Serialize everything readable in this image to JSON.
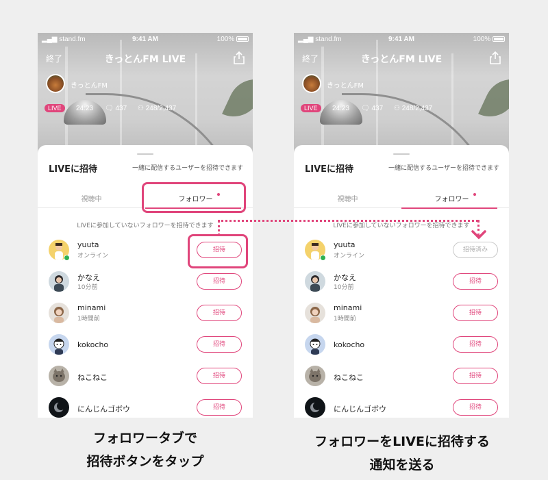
{
  "colors": {
    "accent": "#e0457b",
    "online": "#2fb050",
    "background": "#efefef"
  },
  "status_bar": {
    "carrier": "stand.fm",
    "time": "9:41 AM",
    "battery": "100%"
  },
  "live": {
    "end_label": "終了",
    "title": "きっとんFM LIVE",
    "host_name": "きっとんFM",
    "badge": "LIVE",
    "elapsed": "24:23",
    "comments": "437",
    "listeners": "248/2,437"
  },
  "sheet": {
    "title": "LIVEに招待",
    "description": "一緒に配信するユーザーを招待できます",
    "tabs": [
      {
        "label": "視聴中"
      },
      {
        "label": "フォロワー"
      }
    ],
    "hint": "LIVEに参加していないフォロワーを招待できます"
  },
  "users": [
    {
      "name": "yuuta",
      "sub": "オンライン",
      "online": true,
      "icon": "avatar-yuuta"
    },
    {
      "name": "かなえ",
      "sub": "10分前",
      "online": false,
      "icon": "avatar-kanae"
    },
    {
      "name": "minami",
      "sub": "1時間前",
      "online": false,
      "icon": "avatar-minami"
    },
    {
      "name": "kokocho",
      "sub": "",
      "online": false,
      "icon": "avatar-kokocho"
    },
    {
      "name": "ねこねこ",
      "sub": "",
      "online": false,
      "icon": "avatar-nekoneko"
    },
    {
      "name": "にんじんゴボウ",
      "sub": "",
      "online": false,
      "icon": "avatar-ninjin"
    }
  ],
  "buttons": {
    "invite": "招待",
    "invited": "招待済み"
  },
  "captions": {
    "left": [
      "フォロワータブで",
      "招待ボタンをタップ"
    ],
    "right": [
      "フォロワーをLIVEに招待する",
      "通知を送る"
    ]
  }
}
